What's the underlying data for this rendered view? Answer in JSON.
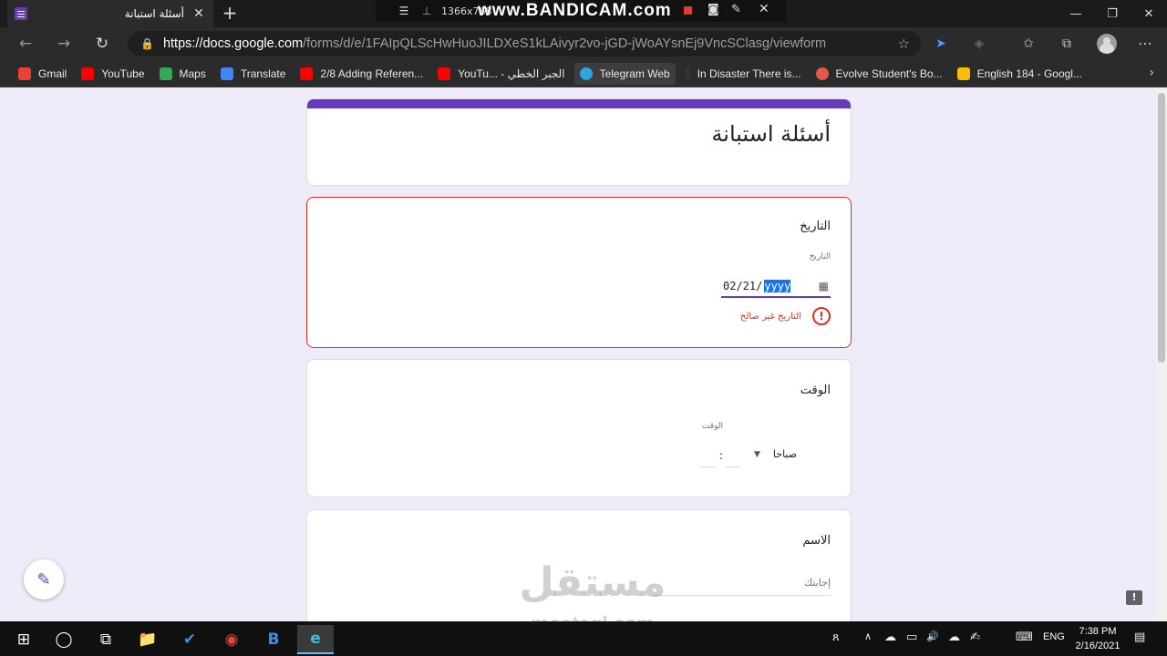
{
  "browser": {
    "tab": {
      "title": "أسئلة استبانة",
      "close": "✕",
      "new_tab": "+"
    },
    "window_controls": {
      "minimize": "—",
      "maximize": "❐",
      "close": "✕"
    },
    "nav": {
      "back": "←",
      "forward": "→",
      "reload": "↻"
    },
    "address": {
      "lock": "🔒",
      "host": "https://docs.google.com",
      "path": "/forms/d/e/1FAIpQLScHwHuoJILDXeS1kLAivyr2vo-jGD-jWoAYsnEj9VncSClasg/viewform",
      "star": "☆"
    },
    "toolbar_icons": {
      "ext_one": "➤",
      "ext_two": "◈",
      "favorites": "✩",
      "collections": "⧉",
      "menu": "⋯"
    },
    "bookmarks": [
      {
        "label": "Gmail",
        "color": "#ea4335"
      },
      {
        "label": "YouTube",
        "color": "#ff0000"
      },
      {
        "label": "Maps",
        "color": "#34a853"
      },
      {
        "label": "Translate",
        "color": "#4285f4"
      },
      {
        "label": "2/8 Adding Referen...",
        "color": "#ff0000"
      },
      {
        "label": "YouTu... - الجبر الخطي",
        "color": "#ff0000"
      },
      {
        "label": "Telegram Web",
        "color": "#2ca5e0"
      },
      {
        "label": "In Disaster There is...",
        "color": "#333333"
      },
      {
        "label": "Evolve Student's Bo...",
        "color": "#e05a47"
      },
      {
        "label": "English 184 - Googl...",
        "color": "#fbbc04"
      }
    ],
    "bookmarks_more": "›"
  },
  "bandicam": {
    "menu": "☰",
    "pin": "⊥",
    "resolution": "1366x768",
    "logo": "www.BANDICAM.com",
    "camera": "◙",
    "pen": "✎",
    "close": "✕"
  },
  "form": {
    "title": "أسئلة استبانة",
    "date_question": {
      "title": "التاريخ",
      "sublabel": "التاريخ",
      "value_prefix": "02/21/",
      "value_year": "yyyy",
      "calendar": "▦",
      "error_icon": "!",
      "error": "التاريخ غير صالح"
    },
    "time_question": {
      "title": "الوقت",
      "sublabel": "الوقت",
      "colon": ":",
      "ampm": "صباحا",
      "dropdown": "▼"
    },
    "name_question": {
      "title": "الاسم",
      "placeholder": "إجابتك"
    },
    "edit": "✎",
    "report": "!"
  },
  "watermark": {
    "arabic": "مستقل",
    "latin": "mostaql.com"
  },
  "taskbar": {
    "start": "⊞",
    "search": "◯",
    "task_view": "⧉",
    "apps": [
      "📁",
      "✔",
      "◉",
      "B",
      "e"
    ],
    "tray": {
      "people": "ጸ",
      "chevron": "∧",
      "onedrive": "☁",
      "battery": "▭",
      "volume": "🔊",
      "network": "☁",
      "pen": "✍",
      "keyboard": "⌨"
    },
    "language": "ENG",
    "time": "7:38 PM",
    "date": "2/16/2021",
    "notifications": "▤"
  }
}
